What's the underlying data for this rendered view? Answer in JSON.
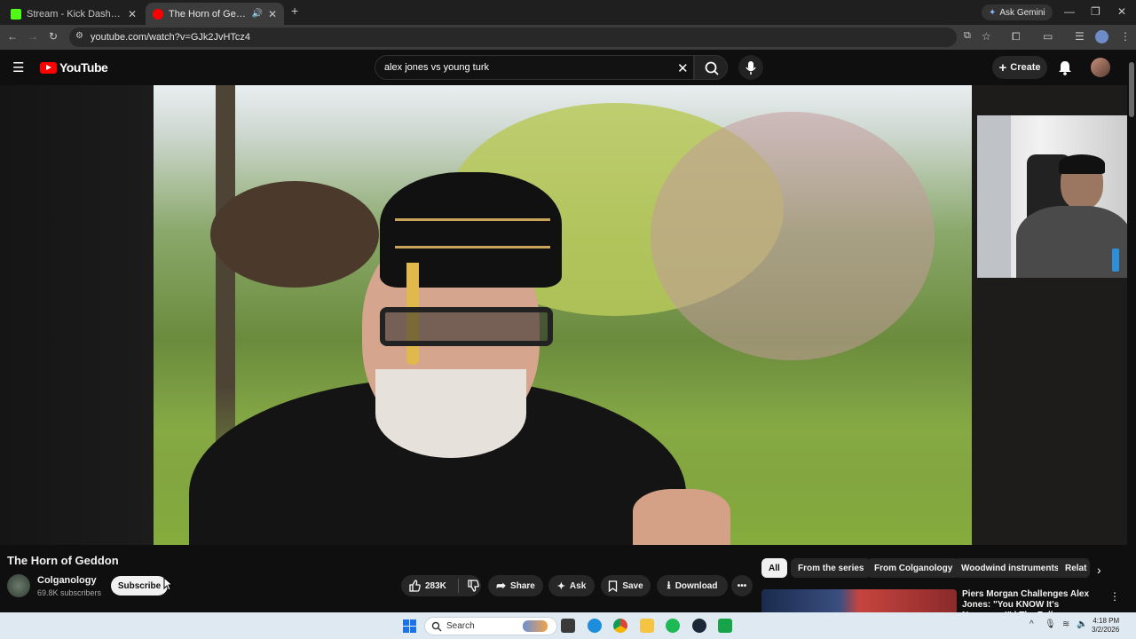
{
  "browser": {
    "tabs": [
      {
        "title": "Stream - Kick Dashboard",
        "active": false
      },
      {
        "title": "The Horn of Geddon - YouTube",
        "active": true
      }
    ],
    "url": "youtube.com/watch?v=GJk2JvHTcz4",
    "ask_gemini_label": "Ask Gemini"
  },
  "youtube": {
    "logo_text": "YouTube",
    "search": {
      "value": "alex jones vs young turk"
    },
    "create_label": "Create"
  },
  "video": {
    "title": "The Horn of Geddon",
    "channel": {
      "name": "Colganology",
      "subscribers": "69.8K subscribers"
    },
    "subscribe_label": "Subscribe",
    "likes": "283K",
    "actions": {
      "share": "Share",
      "ask": "Ask",
      "save": "Save",
      "download": "Download"
    }
  },
  "recommendations": {
    "chips": [
      "All",
      "From the series",
      "From Colganology",
      "Woodwind instruments",
      "Relat"
    ],
    "first_item_title": "Piers Morgan Challenges Alex Jones: \"You KNOW It's Nonsense!\" | The Full..."
  },
  "taskbar": {
    "search_placeholder": "Search",
    "time": "4:18 PM",
    "date": "3/2/2026"
  },
  "colors": {
    "youtube_red": "#ff0000",
    "kick_green": "#53fc18",
    "page_bg": "#0f0f0f"
  }
}
